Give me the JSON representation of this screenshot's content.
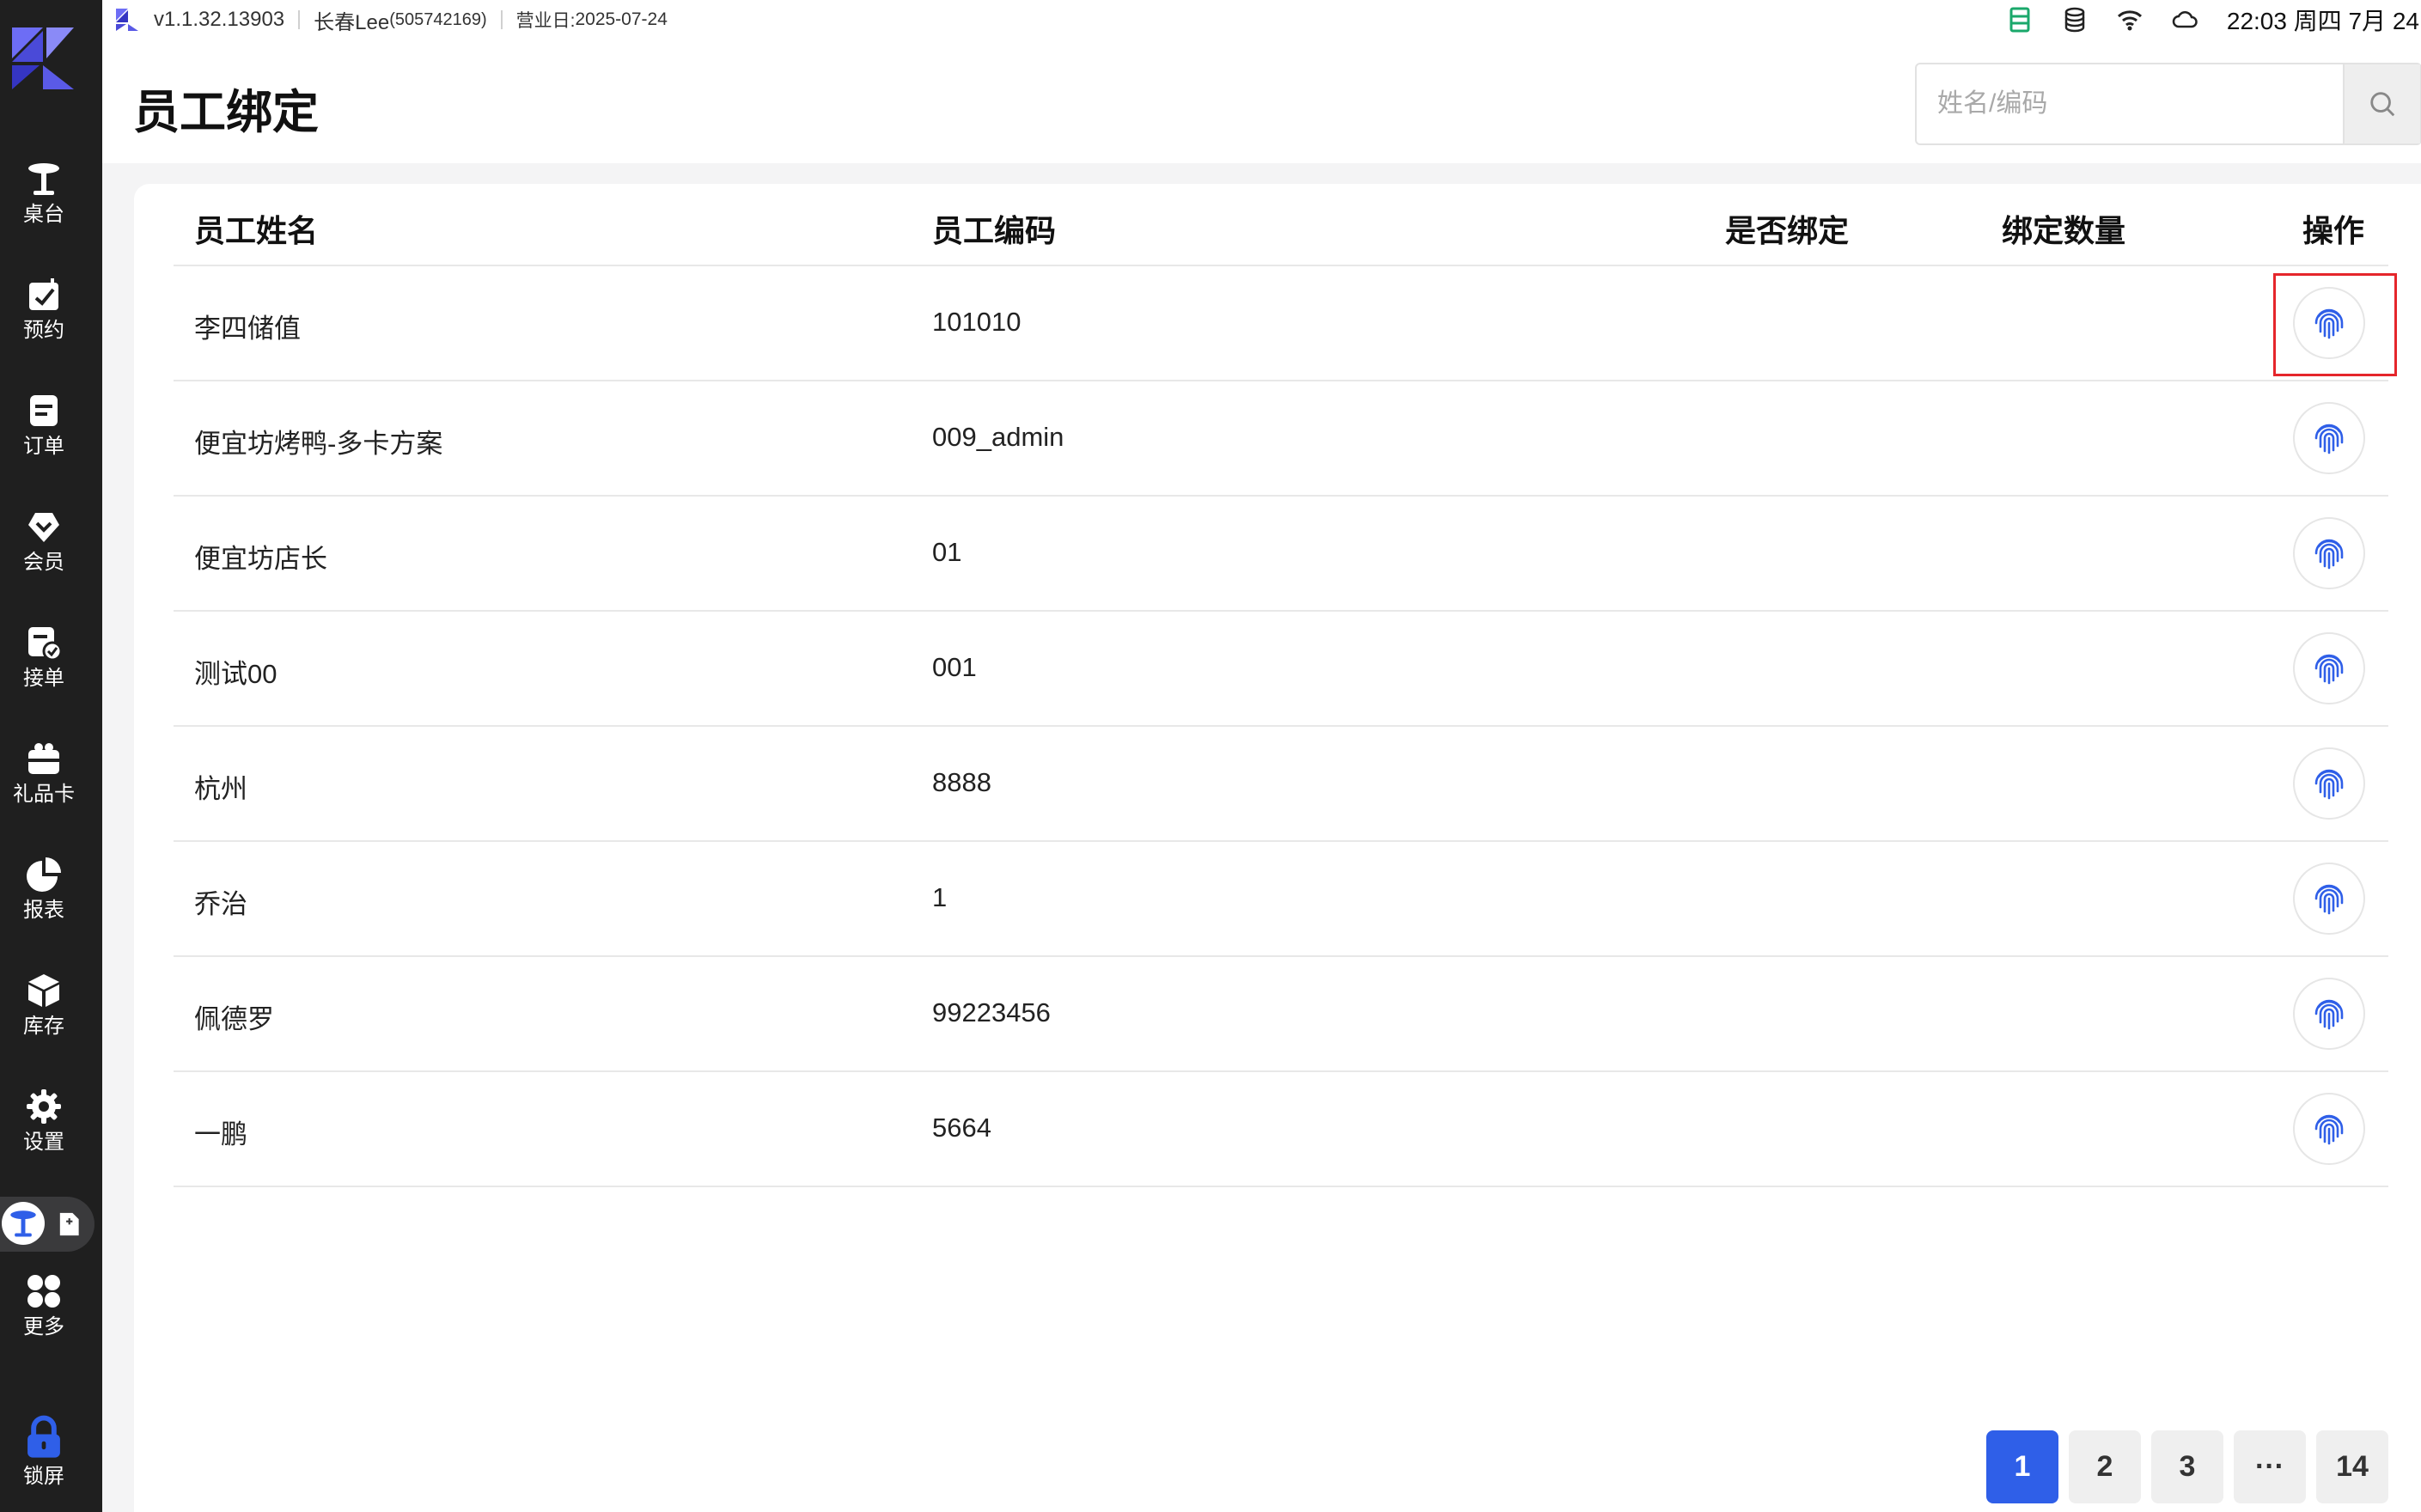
{
  "sidebar": {
    "items": [
      {
        "label": "桌台",
        "icon": "table-icon"
      },
      {
        "label": "预约",
        "icon": "reservation-icon"
      },
      {
        "label": "订单",
        "icon": "order-icon"
      },
      {
        "label": "会员",
        "icon": "member-icon"
      },
      {
        "label": "接单",
        "icon": "accept-order-icon"
      },
      {
        "label": "礼品卡",
        "icon": "gift-card-icon"
      },
      {
        "label": "报表",
        "icon": "report-icon"
      },
      {
        "label": "库存",
        "icon": "inventory-icon"
      },
      {
        "label": "设置",
        "icon": "settings-icon"
      }
    ],
    "more_label": "更多",
    "lock_label": "锁屏"
  },
  "statusbar": {
    "version": "v1.1.32.13903",
    "store_name": "长春Lee",
    "store_id": "(505742169)",
    "business_day_label": "营业日: ",
    "business_day": "2025-07-24",
    "clock": "22:03 周四 7月 24"
  },
  "header": {
    "title": "员工绑定"
  },
  "search": {
    "placeholder": "姓名/编码"
  },
  "table": {
    "columns": [
      "员工姓名",
      "员工编码",
      "是否绑定",
      "绑定数量",
      "操作"
    ],
    "rows": [
      {
        "name": "李四储值",
        "code": "101010",
        "bound": "",
        "count": ""
      },
      {
        "name": "便宜坊烤鸭-多卡方案",
        "code": "009_admin",
        "bound": "",
        "count": ""
      },
      {
        "name": "便宜坊店长",
        "code": "01",
        "bound": "",
        "count": ""
      },
      {
        "name": "测试00",
        "code": "001",
        "bound": "",
        "count": ""
      },
      {
        "name": "杭州",
        "code": "8888",
        "bound": "",
        "count": ""
      },
      {
        "name": "乔治",
        "code": "1",
        "bound": "",
        "count": ""
      },
      {
        "name": "佩德罗",
        "code": "99223456",
        "bound": "",
        "count": ""
      },
      {
        "name": "一鹏",
        "code": "5664",
        "bound": "",
        "count": ""
      }
    ]
  },
  "pagination": {
    "pages": [
      "1",
      "2",
      "3",
      "···",
      "14"
    ],
    "current": "1"
  },
  "colors": {
    "accent": "#2f5fe8",
    "sidebar_bg": "#1f1f1f",
    "highlight": "#e5262b",
    "status_green": "#1aa86b"
  }
}
